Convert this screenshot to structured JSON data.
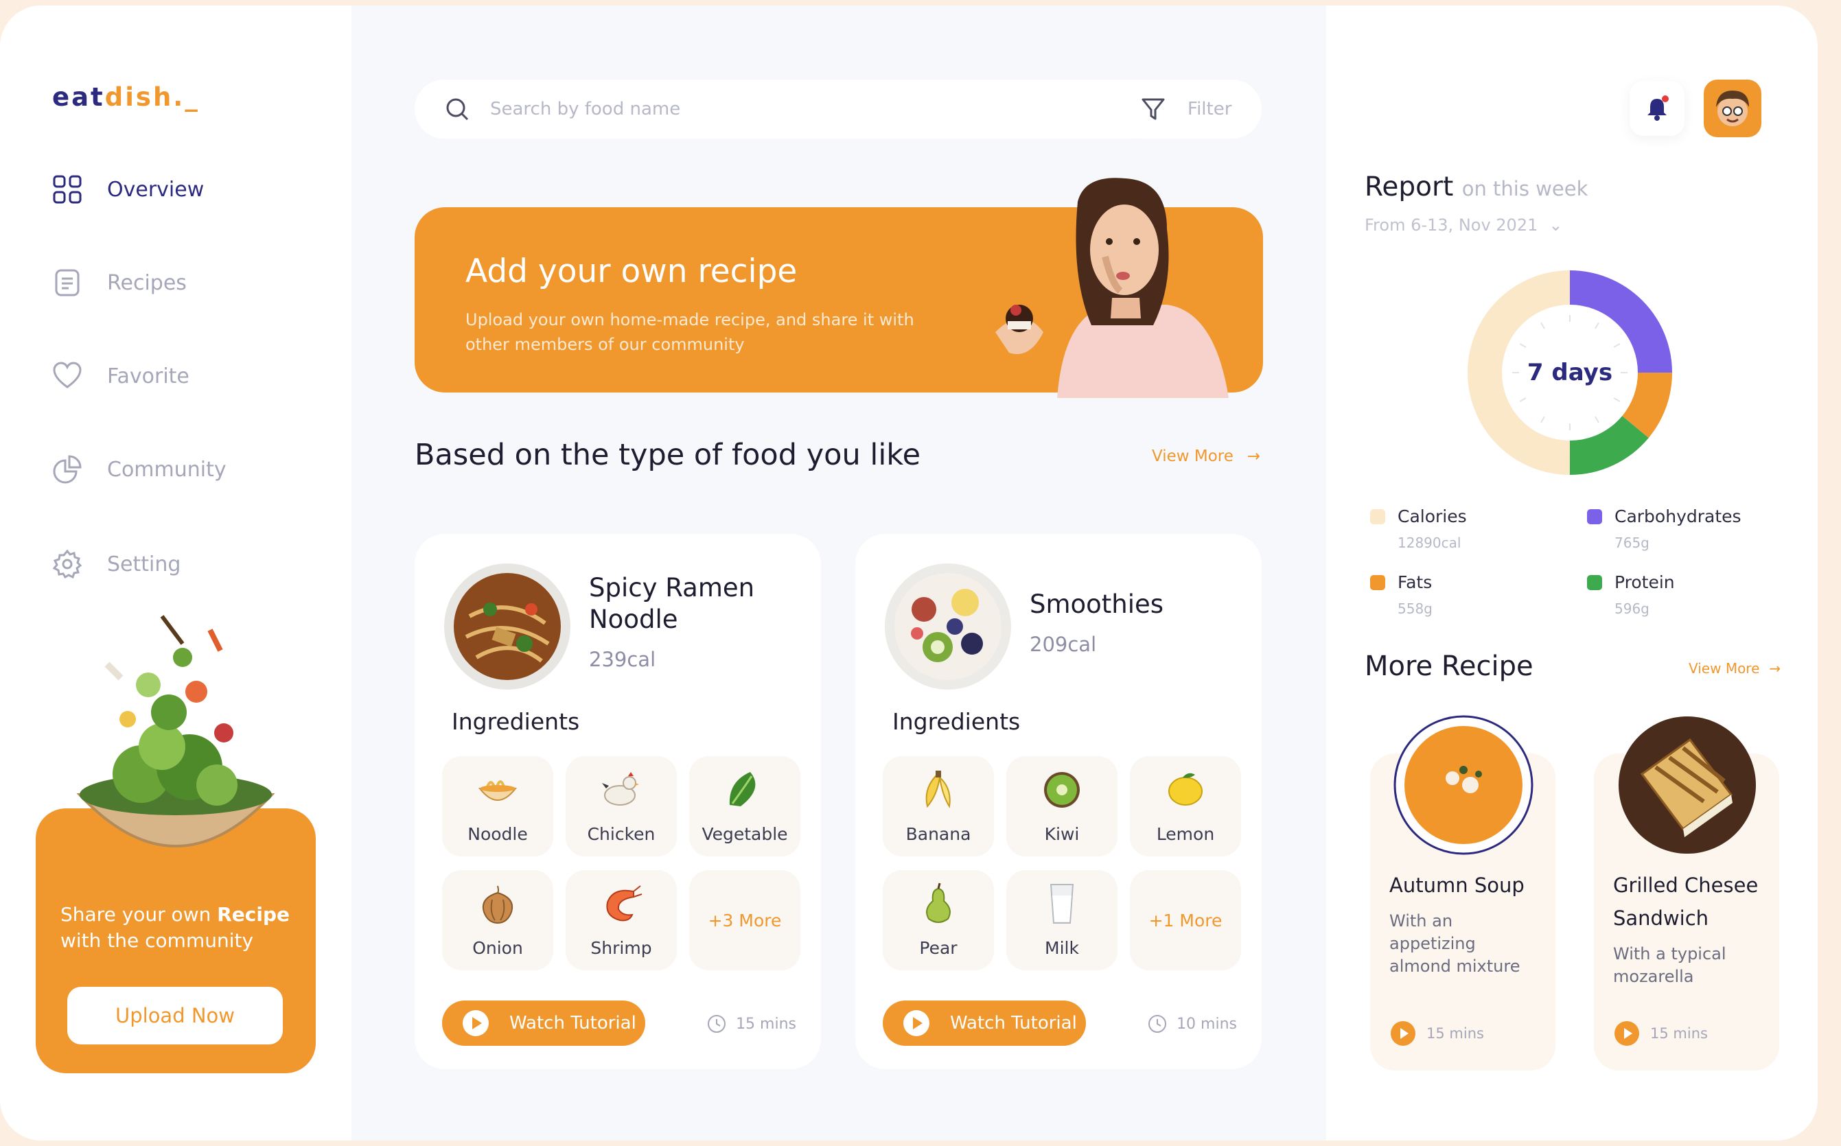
{
  "colors": {
    "accent": "#f0982e",
    "brand": "#2c2a7e",
    "carbs": "#7b61e8",
    "protein": "#3daa4d",
    "calories": "#fbe8c9"
  },
  "logo": {
    "part1": "eat",
    "part2": "dish._"
  },
  "nav": [
    {
      "label": "Overview",
      "icon": "grid-icon",
      "active": true
    },
    {
      "label": "Recipes",
      "icon": "document-icon"
    },
    {
      "label": "Favorite",
      "icon": "heart-icon"
    },
    {
      "label": "Community",
      "icon": "pie-icon"
    },
    {
      "label": "Setting",
      "icon": "gear-icon"
    }
  ],
  "share": {
    "text_before": "Share your own ",
    "text_bold": "Recipe",
    "text_after": " with the community",
    "button": "Upload Now"
  },
  "search": {
    "placeholder": "Search by food name"
  },
  "filter": {
    "label": "Filter"
  },
  "banner": {
    "title": "Add your own recipe",
    "subtitle": "Upload your own home-made recipe, and share it with other members of our community"
  },
  "section": {
    "title": "Based on the type of food you like",
    "view_more": "View More"
  },
  "recipes": [
    {
      "name": "Spicy Ramen Noodle",
      "calories": "239cal",
      "ingredients_title": "Ingredients",
      "ingredients": [
        {
          "name": "Noodle",
          "icon": "noodle-icon"
        },
        {
          "name": "Chicken",
          "icon": "chicken-icon"
        },
        {
          "name": "Vegetable",
          "icon": "vegetable-icon"
        },
        {
          "name": "Onion",
          "icon": "onion-icon"
        },
        {
          "name": "Shrimp",
          "icon": "shrimp-icon"
        }
      ],
      "more": "+3 More",
      "button": "Watch Tutorial",
      "duration": "15 mins"
    },
    {
      "name": "Smoothies",
      "calories": "209cal",
      "ingredients_title": "Ingredients",
      "ingredients": [
        {
          "name": "Banana",
          "icon": "banana-icon"
        },
        {
          "name": "Kiwi",
          "icon": "kiwi-icon"
        },
        {
          "name": "Lemon",
          "icon": "lemon-icon"
        },
        {
          "name": "Pear",
          "icon": "pear-icon"
        },
        {
          "name": "Milk",
          "icon": "milk-icon"
        }
      ],
      "more": "+1 More",
      "button": "Watch Tutorial",
      "duration": "10 mins"
    }
  ],
  "report": {
    "title": "Report",
    "title_muted": "on this week",
    "range": "From 6-13, Nov 2021",
    "center": "7 days",
    "segments": [
      {
        "name": "Carbohydrates",
        "fraction": 0.25,
        "color": "#7b61e8"
      },
      {
        "name": "Fats",
        "fraction": 0.11,
        "color": "#f0982e"
      },
      {
        "name": "Protein",
        "fraction": 0.14,
        "color": "#3daa4d"
      },
      {
        "name": "Calories",
        "fraction": 0.5,
        "color": "#fbe8c9"
      }
    ],
    "legend": [
      {
        "label": "Calories",
        "value": "12890cal",
        "color": "#fbe8c9"
      },
      {
        "label": "Carbohydrates",
        "value": "765g",
        "color": "#7b61e8"
      },
      {
        "label": "Fats",
        "value": "558g",
        "color": "#f0982e"
      },
      {
        "label": "Protein",
        "value": "596g",
        "color": "#3daa4d"
      }
    ]
  },
  "more_recipe": {
    "title": "More Recipe",
    "view_more": "View More",
    "items": [
      {
        "name": "Autumn Soup",
        "desc": "With an appetizing almond mixture",
        "time": "15 mins"
      },
      {
        "name": "Grilled Chesee Sandwich",
        "desc": "With a typical mozarella",
        "time": "15 mins"
      }
    ]
  }
}
